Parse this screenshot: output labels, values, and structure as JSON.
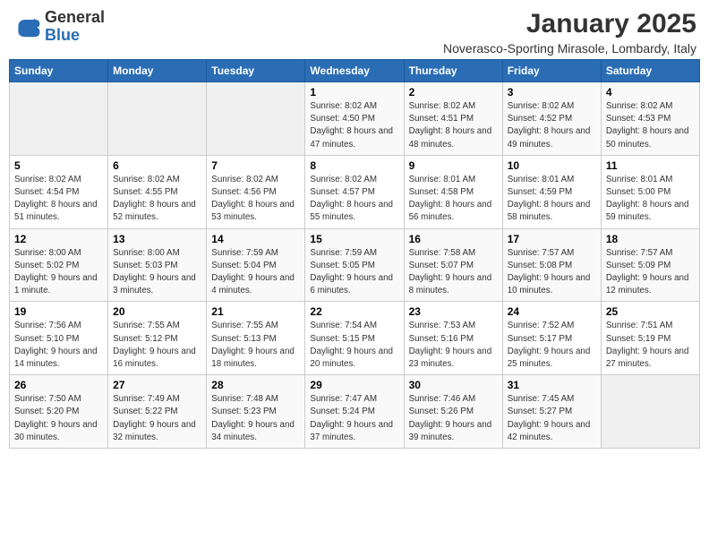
{
  "header": {
    "logo_general": "General",
    "logo_blue": "Blue",
    "month": "January 2025",
    "location": "Noverasco-Sporting Mirasole, Lombardy, Italy"
  },
  "weekdays": [
    "Sunday",
    "Monday",
    "Tuesday",
    "Wednesday",
    "Thursday",
    "Friday",
    "Saturday"
  ],
  "weeks": [
    [
      {
        "day": "",
        "empty": true
      },
      {
        "day": "",
        "empty": true
      },
      {
        "day": "",
        "empty": true
      },
      {
        "day": "1",
        "sunrise": "8:02 AM",
        "sunset": "4:50 PM",
        "daylight": "8 hours and 47 minutes."
      },
      {
        "day": "2",
        "sunrise": "8:02 AM",
        "sunset": "4:51 PM",
        "daylight": "8 hours and 48 minutes."
      },
      {
        "day": "3",
        "sunrise": "8:02 AM",
        "sunset": "4:52 PM",
        "daylight": "8 hours and 49 minutes."
      },
      {
        "day": "4",
        "sunrise": "8:02 AM",
        "sunset": "4:53 PM",
        "daylight": "8 hours and 50 minutes."
      }
    ],
    [
      {
        "day": "5",
        "sunrise": "8:02 AM",
        "sunset": "4:54 PM",
        "daylight": "8 hours and 51 minutes."
      },
      {
        "day": "6",
        "sunrise": "8:02 AM",
        "sunset": "4:55 PM",
        "daylight": "8 hours and 52 minutes."
      },
      {
        "day": "7",
        "sunrise": "8:02 AM",
        "sunset": "4:56 PM",
        "daylight": "8 hours and 53 minutes."
      },
      {
        "day": "8",
        "sunrise": "8:02 AM",
        "sunset": "4:57 PM",
        "daylight": "8 hours and 55 minutes."
      },
      {
        "day": "9",
        "sunrise": "8:01 AM",
        "sunset": "4:58 PM",
        "daylight": "8 hours and 56 minutes."
      },
      {
        "day": "10",
        "sunrise": "8:01 AM",
        "sunset": "4:59 PM",
        "daylight": "8 hours and 58 minutes."
      },
      {
        "day": "11",
        "sunrise": "8:01 AM",
        "sunset": "5:00 PM",
        "daylight": "8 hours and 59 minutes."
      }
    ],
    [
      {
        "day": "12",
        "sunrise": "8:00 AM",
        "sunset": "5:02 PM",
        "daylight": "9 hours and 1 minute."
      },
      {
        "day": "13",
        "sunrise": "8:00 AM",
        "sunset": "5:03 PM",
        "daylight": "9 hours and 3 minutes."
      },
      {
        "day": "14",
        "sunrise": "7:59 AM",
        "sunset": "5:04 PM",
        "daylight": "9 hours and 4 minutes."
      },
      {
        "day": "15",
        "sunrise": "7:59 AM",
        "sunset": "5:05 PM",
        "daylight": "9 hours and 6 minutes."
      },
      {
        "day": "16",
        "sunrise": "7:58 AM",
        "sunset": "5:07 PM",
        "daylight": "9 hours and 8 minutes."
      },
      {
        "day": "17",
        "sunrise": "7:57 AM",
        "sunset": "5:08 PM",
        "daylight": "9 hours and 10 minutes."
      },
      {
        "day": "18",
        "sunrise": "7:57 AM",
        "sunset": "5:09 PM",
        "daylight": "9 hours and 12 minutes."
      }
    ],
    [
      {
        "day": "19",
        "sunrise": "7:56 AM",
        "sunset": "5:10 PM",
        "daylight": "9 hours and 14 minutes."
      },
      {
        "day": "20",
        "sunrise": "7:55 AM",
        "sunset": "5:12 PM",
        "daylight": "9 hours and 16 minutes."
      },
      {
        "day": "21",
        "sunrise": "7:55 AM",
        "sunset": "5:13 PM",
        "daylight": "9 hours and 18 minutes."
      },
      {
        "day": "22",
        "sunrise": "7:54 AM",
        "sunset": "5:15 PM",
        "daylight": "9 hours and 20 minutes."
      },
      {
        "day": "23",
        "sunrise": "7:53 AM",
        "sunset": "5:16 PM",
        "daylight": "9 hours and 23 minutes."
      },
      {
        "day": "24",
        "sunrise": "7:52 AM",
        "sunset": "5:17 PM",
        "daylight": "9 hours and 25 minutes."
      },
      {
        "day": "25",
        "sunrise": "7:51 AM",
        "sunset": "5:19 PM",
        "daylight": "9 hours and 27 minutes."
      }
    ],
    [
      {
        "day": "26",
        "sunrise": "7:50 AM",
        "sunset": "5:20 PM",
        "daylight": "9 hours and 30 minutes."
      },
      {
        "day": "27",
        "sunrise": "7:49 AM",
        "sunset": "5:22 PM",
        "daylight": "9 hours and 32 minutes."
      },
      {
        "day": "28",
        "sunrise": "7:48 AM",
        "sunset": "5:23 PM",
        "daylight": "9 hours and 34 minutes."
      },
      {
        "day": "29",
        "sunrise": "7:47 AM",
        "sunset": "5:24 PM",
        "daylight": "9 hours and 37 minutes."
      },
      {
        "day": "30",
        "sunrise": "7:46 AM",
        "sunset": "5:26 PM",
        "daylight": "9 hours and 39 minutes."
      },
      {
        "day": "31",
        "sunrise": "7:45 AM",
        "sunset": "5:27 PM",
        "daylight": "9 hours and 42 minutes."
      },
      {
        "day": "",
        "empty": true
      }
    ]
  ],
  "labels": {
    "sunrise_prefix": "Sunrise: ",
    "sunset_prefix": "Sunset: ",
    "daylight_prefix": "Daylight: "
  }
}
